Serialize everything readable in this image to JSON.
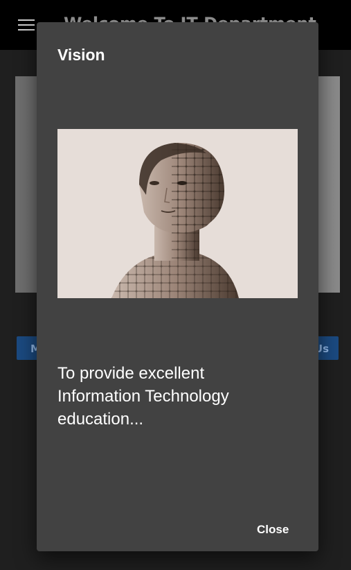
{
  "app": {
    "title": "Welcome To IT Department",
    "left_button_label": "M",
    "right_button_label": "Us"
  },
  "dialog": {
    "title": "Vision",
    "text": "To provide excellent Information Technology education...",
    "close_label": "Close",
    "image_subject": "ai-face-circuit-illustration"
  },
  "colors": {
    "dialog_bg": "#424242",
    "appbar_bg": "#000000",
    "button_bg": "#1b4a80"
  }
}
